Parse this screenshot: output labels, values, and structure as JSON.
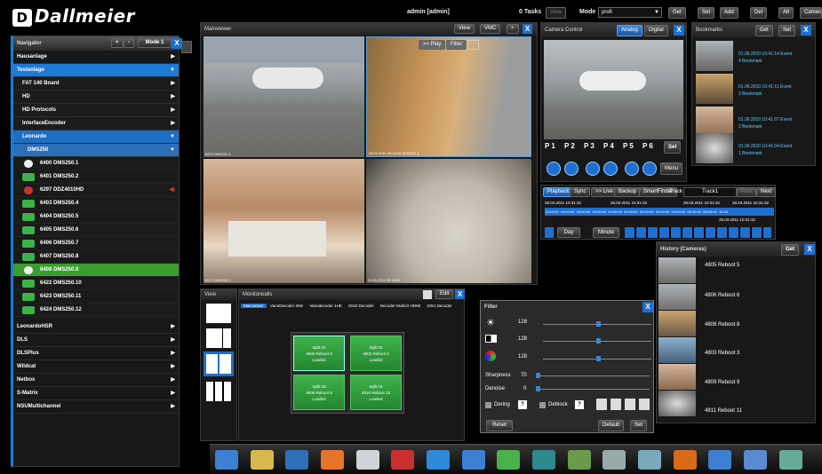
{
  "brand": {
    "logo": "Dallmeier",
    "logo_mark": "D"
  },
  "topbar": {
    "user": "admin [admin]",
    "tasks": "0 Tasks",
    "view_label": "View",
    "mode_label": "Mode",
    "mode_value": "profi",
    "get": "Get",
    "set": "Set",
    "add": "Add",
    "del": "Del",
    "alt": "Alt",
    "camera": "Camera"
  },
  "navigator": {
    "title": "Navigator",
    "plus": "+",
    "minus": "-",
    "mode": "Mode 1",
    "close": "X",
    "items": [
      {
        "label": "Hausanlage"
      },
      {
        "label": "Testanlage"
      },
      {
        "label": "FAT 140 Board"
      },
      {
        "label": "HD"
      },
      {
        "label": "HD Protocols"
      },
      {
        "label": "InterfaceEncoder"
      },
      {
        "label": "Leonardo"
      },
      {
        "label": "DMS250"
      }
    ],
    "cameras": [
      {
        "label": "6400 DMS250.1"
      },
      {
        "label": "6401 DMS250.2"
      },
      {
        "label": "6297 DDZ4010HD"
      },
      {
        "label": "6403 DMS250.4"
      },
      {
        "label": "6404 DMS250.5"
      },
      {
        "label": "6405 DMS250.6"
      },
      {
        "label": "6406 DMS250.7"
      },
      {
        "label": "6407 DMS250.8"
      },
      {
        "label": "6408 DMS250.9"
      },
      {
        "label": "6422 DMS250.10"
      },
      {
        "label": "6423 DMS250.11"
      },
      {
        "label": "6424 DMS250.12"
      }
    ],
    "bottom_items": [
      {
        "label": "LeonardoHSR"
      },
      {
        "label": "DLS"
      },
      {
        "label": "DLSPlus"
      },
      {
        "label": "Wildcat"
      },
      {
        "label": "Netbox"
      },
      {
        "label": "S-Matrix"
      },
      {
        "label": "NSUMultichannel"
      }
    ]
  },
  "mainviewer": {
    "title": "Mainviewer",
    "view": "View",
    "vmc": "VMC",
    "plus": "+",
    "close": "X",
    "play": ">> Play",
    "filter": "Filter",
    "tile_captions": [
      "6572 DMS251.1",
      "26.01.2011 09:18:52 DMS241.1",
      "6571 DMS251.1",
      "26.01.2011 09:18:52"
    ]
  },
  "camera_control": {
    "title": "Camera Control",
    "analog": "Analog",
    "digital": "Digital",
    "close": "X",
    "presets": [
      "P 1",
      "P 2",
      "P 3",
      "P 4",
      "P 5",
      "P 6"
    ],
    "set": "Set",
    "menu": "Menu"
  },
  "bookmarks": {
    "title": "Bookmarks",
    "get": "Get",
    "set": "Set",
    "close": "X",
    "items": [
      {
        "date": "01.06.2010 10:41:14 Event",
        "name": "4 Bookmark"
      },
      {
        "date": "01.06.2010 10:41:11 Event",
        "name": "3 Bookmark"
      },
      {
        "date": "01.06.2010 10:41:07 Event",
        "name": "2 Bookmark"
      },
      {
        "date": "01.06.2010 10:41:04 Event",
        "name": "1 Bookmark"
      }
    ]
  },
  "playback": {
    "tabs": [
      "Playback",
      "Sync",
      ">> Live",
      "Backup",
      "SmartFinder",
      "Track"
    ],
    "track_value": "Track1",
    "prev": "Prev",
    "next": "Next",
    "dates": [
      "28.03.2011 10:31:32",
      "28.03.2011 10:31:32",
      "28.03.2011 10:31:32",
      "28.03.2011 10:31:32",
      "29.03.2011 10:31:32"
    ],
    "timeline": [
      "12:00:00",
      "14:00:00",
      "16:00:00",
      "18:00:00",
      "20:00:00",
      "22:00:00",
      "00:00:00",
      "02:00:00",
      "04:00:00",
      "06:00:00",
      "08:00:00",
      "10:00"
    ],
    "day": "Day",
    "minute": "Minute"
  },
  "history": {
    "title": "History (Cameras)",
    "get": "Get",
    "close": "X",
    "items": [
      {
        "label": "4805 Reboot 5"
      },
      {
        "label": "4806 Reboot 6"
      },
      {
        "label": "4808 Reboot 8"
      },
      {
        "label": "4803 Reboot 3"
      },
      {
        "label": "4809 Reboot 9"
      },
      {
        "label": "4811 Reboot 11"
      }
    ]
  },
  "view_panel": {
    "title": "View"
  },
  "monitorwalls": {
    "title": "Monitorwalls",
    "edit": "Edit",
    "close": "X",
    "tabs": [
      "Mainviewer",
      "VarioDecoder 3HE",
      "Variodecoder 1HE",
      "DIS2 Decoder",
      "Decoder-Multi-D HDMI",
      "DIS1 Decoder"
    ],
    "splits": [
      {
        "title": "Split 01",
        "cam": "4805 Reboot 5",
        "sub": "Loaded"
      },
      {
        "title": "Split 02",
        "cam": "4803 Reboot 3",
        "sub": "Loaded"
      },
      {
        "title": "Split 03",
        "cam": "4808 Reboot 8",
        "sub": "Loaded"
      },
      {
        "title": "Split 04",
        "cam": "4810 Reboot 10",
        "sub": "Loaded"
      }
    ]
  },
  "filter": {
    "title": "Filter",
    "close": "X",
    "brightness": "128",
    "contrast": "128",
    "saturation": "128",
    "sharpness_label": "Sharpness",
    "sharpness": "70",
    "denoise_label": "Denoise",
    "denoise": "0",
    "dering": "Dering",
    "deblock": "Deblock",
    "help": "?",
    "reset": "Reset",
    "default": "Default",
    "set": "Set"
  },
  "colors": {
    "accent": "#1d7bd7",
    "green": "#3a9e2e",
    "panel": "#181818"
  }
}
